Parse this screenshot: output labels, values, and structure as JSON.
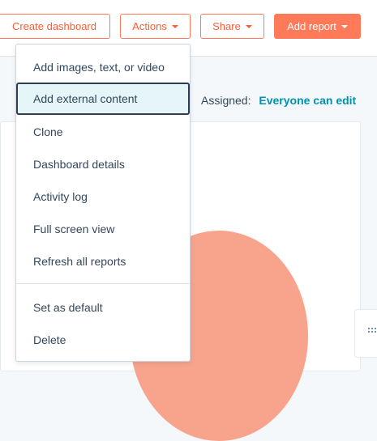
{
  "toolbar": {
    "create_dashboard": "Create dashboard",
    "actions": "Actions",
    "share": "Share",
    "add_report": "Add report"
  },
  "assigned": {
    "label": "Assigned:",
    "value": "Everyone can edit"
  },
  "actions_menu": {
    "items": [
      "Add images, text, or video",
      "Add external content",
      "Clone",
      "Dashboard details",
      "Activity log",
      "Full screen view",
      "Refresh all reports",
      "Set as default",
      "Delete"
    ],
    "highlighted": "Add external content"
  },
  "colors": {
    "accent": "#ff7a59",
    "link": "#0091ae",
    "text": "#33475b"
  },
  "icons": {
    "dropdown": "caret-down-icon",
    "drag_handle": "grip-icon"
  }
}
